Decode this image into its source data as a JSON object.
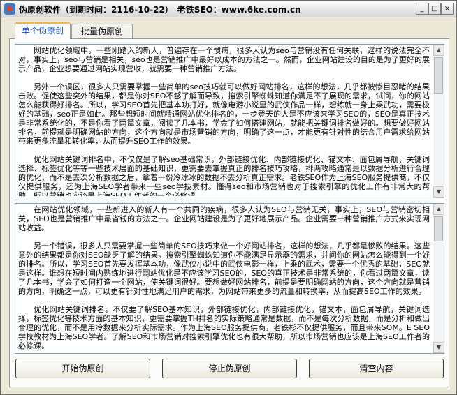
{
  "window": {
    "title": "伪原创软件（到期时间：2116-10-22）　老铁SEO：www.6ke.com.cn",
    "buttons": {
      "minimize": "_",
      "maximize": "□",
      "close": "×"
    }
  },
  "tabs": [
    {
      "label": "单个伪原创",
      "active": true
    },
    {
      "label": "批量伪原创",
      "active": false
    }
  ],
  "input_text": [
    "网站优化领域中，一些刚踏入的新人，普遍存在一个惯病，很多人认为seo与营销没有任何关联，这样的说法完全不对，事实上，seo与营销是相关，seo也是营销推广中最好以成本的方法之一。然而，企业网站建设的目的是为了更好的展示产品，企业想要通过网站实现营收，就需要一种营销推广方法。",
    "另外一个误区，很多人只需要掌握一些简单的seo技巧就可以做好网站排名，这样的想法，几乎都被惨目忍睹的结果击败。促使这些突外的结果，都是你对SEO不够了解而导致，搜索引擎蜘蛛知道你满足不了展现的需求，试问，你的网站怎么能获得好排名。所以，学习SEO首先把基本功打好，就像电游小说里的武侠作品一样，想练就一身上乘武功，需要极好的基础，seo正是如此。那些想短时间就精通网站优化排名的，一步登天的人是不应该来学习SEO的，SEO是真正技术是非常系统化的，不是你看了两篇文章，阅读了几本书，学会了如何搭建网站，就能把关键词排名做好的。想要做好网站排名，前提就是明确网站的方向，这个方向就是市场营销的方向，明确了这一点，才能更有针对性的结合用户需求给网站带来更多流量和转化率，从而提升SEO工作的效果。",
    "优化网站关键词排名中，不仅仅是了解seo基础常识，外部链接优化、内部链接优化、锚文本、面包屑导航、关键词选择、标签优化等等一些技术层面的基础知识，更需要去掌握真正的排名技巧攻略，排两攻略通常是以数据分析进行合理的优化，而不是去次分析数据之后，拿着一份冷冰冰的数据不去分析真正需求。老铁SEO作为上海SEO服务提供商，不仅仅提供服务，还为上海SEO学者带来一些seo学技素材。懂得seo和市场营销也对于搜索引擎的优化工作有非常大的帮助，所以营销也应该是上海SEO工作者的一个必修课。"
  ],
  "output_text": [
    "在网站优化领域，一些新进入的新人有一个共同的疾病，很多人认为SEO与营销无关，事实上，SEO与营销密切相关，SEO也是营销推广中最省钱的方法之一。企业网站建设是为了更好地展示产品。企业需要一种营销推广方式来实现网站收益。",
    "另一个错误，很多人只需要掌握一些简单的SEO技巧来做一个好网站排名，这样的想法，几乎都是惨败的结果。这些意外的结果都是你对SEO缺乏了解的结果。搜索引擎蜘蛛知道你不能满足显示器的需求，并问你的网站怎么能得到一个好的排名。所以，学习SEO首先要发挥基本功，像武侠小说中的武侠电影一样，上乘的武术，需要一个优秀的基础，SEO就是这样。谁想在短时间内熟练地进行网站优化是不应该学习SEO的，SEO的真正技术是非常系统的，你看过两篇文章，读了几本书，学会了如何打造一个网站，使关键词很好。要想做好网站排名，前提是要明确网站的方向，这个方向就是营销的方向，明确这一点，可以更有针对性地满足用户的需求，为网站带来更多的流量和转换率，从而提高SEO工作的效果。",
    "优化网站关键词排名，不仅要了解SEO基本知识，外部链接优化，内部链接优化，锚文本，面包屑导航，关键词选择，标签优化等技术方面的基本知识，更需要掌握TH排名的实际策略通常是数据，而不是每次分析数据，而是分析和做出合理的优化，而不是用冷数据来分析实际需求。作为上海SEO服务提供商，老铁杉不仅提供服务，而且带来SOM。E SEO学校教材为上海SEO学者。了解SEO和市场营销对搜索引擎优化也有很大帮助，所以市场营销也应该是上海SEO工作者的必修课。"
  ],
  "buttons": {
    "start": "开始伪原创",
    "stop": "停止伪原创",
    "clear": "清空内容"
  },
  "scroll_glyphs": {
    "up": "▲",
    "down": "▼"
  }
}
